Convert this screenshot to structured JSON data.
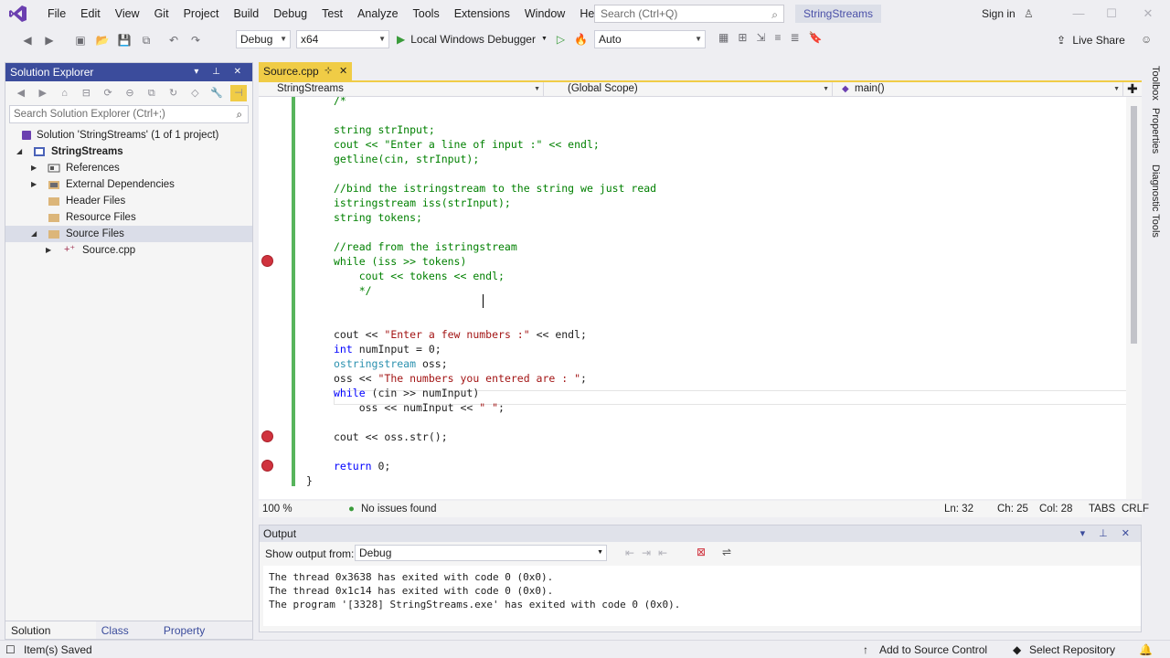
{
  "menu": {
    "items": [
      "File",
      "Edit",
      "View",
      "Git",
      "Project",
      "Build",
      "Debug",
      "Test",
      "Analyze",
      "Tools",
      "Extensions",
      "Window",
      "Help"
    ],
    "search_placeholder": "Search (Ctrl+Q)",
    "solution_name": "StringStreams",
    "sign_in": "Sign in",
    "min": "—",
    "max": "☐",
    "close": "✕"
  },
  "toolbar": {
    "configuration": "Debug",
    "platform": "x64",
    "run_label": "Local Windows Debugger",
    "auto_label": "Auto",
    "live_share": "Live Share"
  },
  "solution_explorer": {
    "title": "Solution Explorer",
    "search_placeholder": "Search Solution Explorer (Ctrl+;)",
    "tree": [
      {
        "label": "Solution 'StringStreams' (1 of 1 project)",
        "icon": "solution-icon"
      },
      {
        "label": "StringStreams",
        "icon": "project-icon"
      },
      {
        "label": "References",
        "icon": "references-icon"
      },
      {
        "label": "External Dependencies",
        "icon": "folder-icon"
      },
      {
        "label": "Header Files",
        "icon": "folder-icon"
      },
      {
        "label": "Resource Files",
        "icon": "folder-icon"
      },
      {
        "label": "Source Files",
        "icon": "folder-icon"
      },
      {
        "label": "Source.cpp",
        "icon": "cpp-file-icon"
      }
    ],
    "bottom_tabs": [
      "Solution Explorer",
      "Class View",
      "Property Manager"
    ]
  },
  "editor": {
    "tab_title": "Source.cpp",
    "nav_project": "StringStreams",
    "nav_scope": "(Global Scope)",
    "nav_member": "main()",
    "zoom": "100 %",
    "issues": "No issues found",
    "ln": "Ln: 32",
    "ch": "Ch: 25",
    "col": "Col: 28",
    "tabs": "TABS",
    "eol": "CRLF"
  },
  "code_lines": [
    "/*",
    "string strInput;",
    "cout << \"Enter a line of input :\" << endl;",
    "getline(cin, strInput);",
    "",
    "//bind the istringstream to the string we just read",
    "istringstream iss(strInput);",
    "string tokens;",
    "",
    "//read from the istringstream",
    "while (iss >> tokens)",
    "    cout << tokens << endl;",
    "    */",
    "",
    "",
    "cout << \"Enter a few numbers :\" << endl;",
    "int numInput = 0;",
    "ostringstream oss;",
    "oss << \"The numbers you entered are : \";",
    "while (cin >> numInput)",
    "    oss << numInput << \" \";",
    "",
    "cout << oss.str();",
    "",
    "return 0;",
    "}"
  ],
  "output": {
    "title": "Output",
    "show_from_label": "Show output from:",
    "source": "Debug",
    "lines": [
      "The thread 0x3638 has exited with code 0 (0x0).",
      "The thread 0x1c14 has exited with code 0 (0x0).",
      "The program '[3328] StringStreams.exe' has exited with code 0 (0x0)."
    ]
  },
  "side_panels": [
    "Toolbox",
    "Properties",
    "Diagnostic Tools"
  ],
  "status": {
    "message": "Item(s) Saved",
    "add_source_control": "Add to Source Control",
    "select_repository": "Select Repository"
  },
  "colors": {
    "accent": "#3b4c9c",
    "tab_active": "#f0cc46",
    "breakpoint": "#d0333e",
    "changed_bar": "#57b45c"
  }
}
